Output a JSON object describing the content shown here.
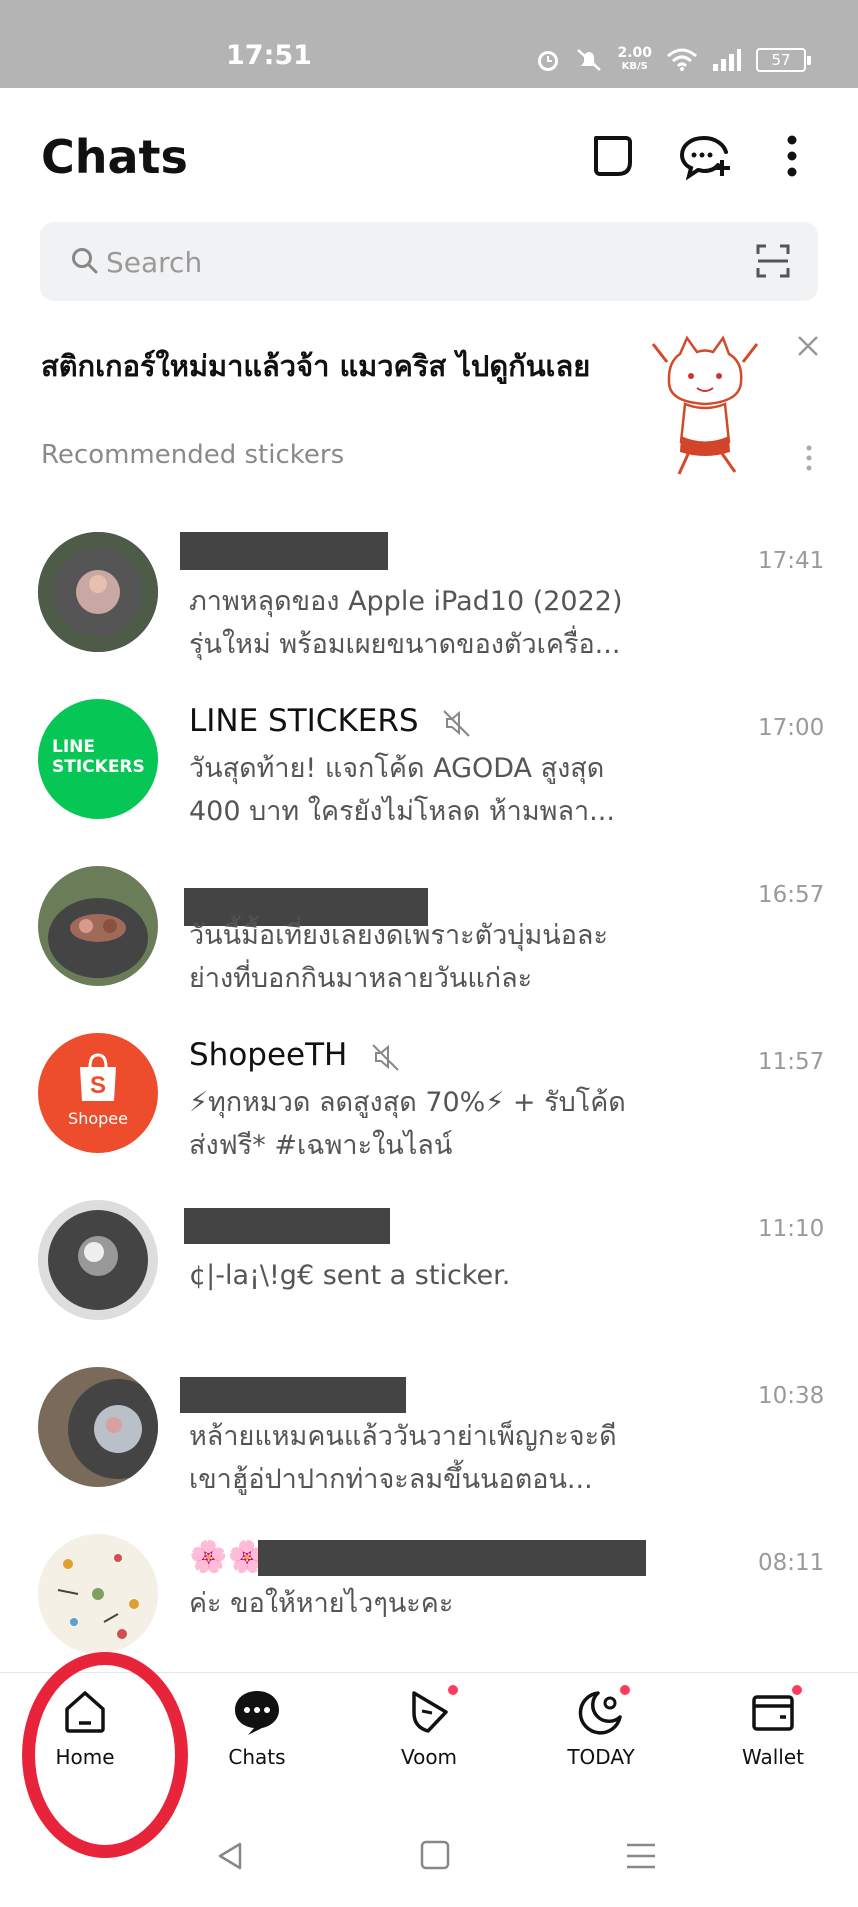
{
  "status_bar": {
    "time": "17:51",
    "speed_value": "2.00",
    "speed_unit": "KB/S",
    "battery": "57"
  },
  "header": {
    "title": "Chats"
  },
  "search": {
    "placeholder": "Search"
  },
  "banner": {
    "headline": "สติกเกอร์ใหม่มาแล้วจ้า แมวคริส ไปดูกันเลย",
    "subtitle": "Recommended stickers"
  },
  "chats": [
    {
      "name": "",
      "preview": "ภาพหลุดของ Apple iPad10 (2022) รุ่นใหม่ พร้อมเผยขนาดของตัวเครื่อ...",
      "time": "17:41"
    },
    {
      "name": "LINE STICKERS",
      "preview": "วันสุดท้าย! แจกโค้ด AGODA สูงสุด 400 บาท ใครยังไม่โหลด ห้ามพลา...",
      "time": "17:00",
      "muted": true,
      "avatar_text_1": "LINE",
      "avatar_text_2": "STICKERS"
    },
    {
      "name": "",
      "preview": "วันนี้มื้อเที่ยงเลยงดเพราะตัวบุ่มน่อละย่างที่บอกกินมาหลายวันแก่ละ",
      "time": "16:57"
    },
    {
      "name": "ShopeeTH",
      "preview": "⚡ทุกหมวด ลดสูงสุด 70%⚡ + รับโค้ดส่งฟรี* #เฉพาะในไลน์",
      "time": "11:57",
      "muted": true,
      "avatar_text": "Shopee"
    },
    {
      "name": "",
      "preview": "¢|-la¡\\!g€ sent a sticker.",
      "time": "11:10"
    },
    {
      "name": "",
      "preview": "หล้ายแหมคนแล้ววันวาย่าเพ็ญกะจะดีเขาฮู้อ่ปาปากท่าจะลมขึ้นนอตอน...",
      "time": "10:38"
    },
    {
      "name": "🌸🌸",
      "preview": "ค่ะ ขอให้หายไวๆนะคะ",
      "time": "08:11"
    }
  ],
  "bottom_nav": [
    {
      "label": "Home",
      "icon": "home-icon"
    },
    {
      "label": "Chats",
      "icon": "chat-bubble-icon"
    },
    {
      "label": "Voom",
      "icon": "voom-play-icon"
    },
    {
      "label": "TODAY",
      "icon": "today-moon-icon"
    },
    {
      "label": "Wallet",
      "icon": "wallet-icon"
    }
  ],
  "colors": {
    "accent_green": "#06c755",
    "shopee_orange": "#ee4d2d",
    "highlight_red": "#e8243b",
    "notification_dot": "#ff3b5c"
  }
}
